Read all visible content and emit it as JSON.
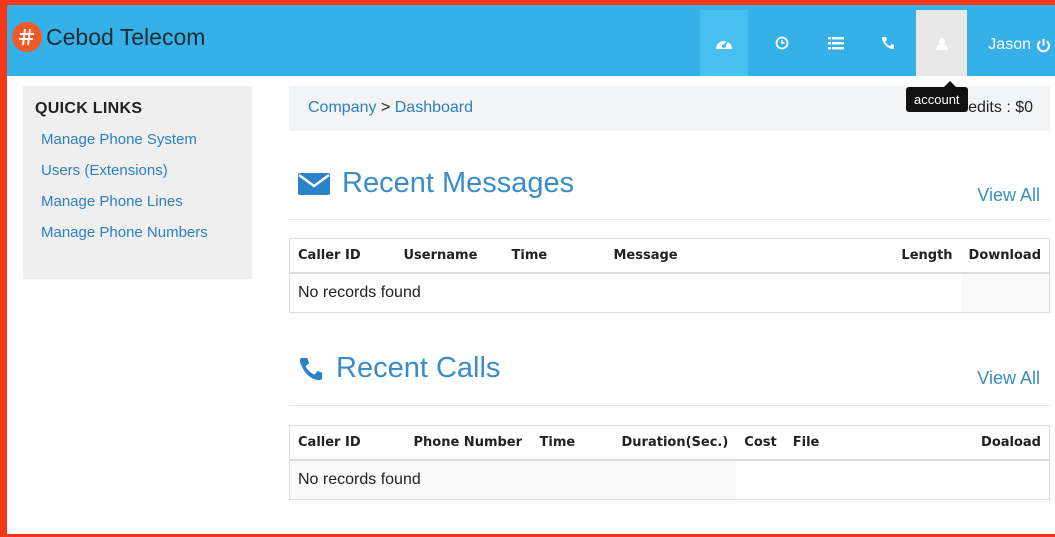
{
  "app": {
    "title": "Cebod Telecom"
  },
  "header": {
    "icons": [
      {
        "name": "dashboard-icon",
        "glyph": "◕",
        "active": true
      },
      {
        "name": "history-icon",
        "glyph": "◷"
      },
      {
        "name": "list-icon",
        "glyph": "☰"
      },
      {
        "name": "phone-icon",
        "glyph": "☎"
      },
      {
        "name": "account-icon",
        "glyph": "☺"
      }
    ],
    "user_name": "Jason",
    "logout_glyph": "⏻",
    "tooltip": "account"
  },
  "sidebar": {
    "title": "QUICK LINKS",
    "items": [
      {
        "label": "Manage Phone System"
      },
      {
        "label": "Users (Extensions)"
      },
      {
        "label": "Manage Phone Lines"
      },
      {
        "label": "Manage Phone Numbers"
      }
    ]
  },
  "breadcrumb": {
    "parent": "Company",
    "separator": ">",
    "current": "Dashboard",
    "credits": "Credits : $0"
  },
  "messages": {
    "title": "Recent Messages",
    "view_all": "View All",
    "columns": [
      "Caller ID",
      "Username",
      "Time",
      "Message",
      "Length",
      "Download"
    ],
    "empty": "No records found"
  },
  "calls": {
    "title": "Recent Calls",
    "view_all": "View All",
    "columns": [
      "Caller ID",
      "Phone Number",
      "Time",
      "Duration(Sec.)",
      "Cost",
      "File",
      "Doaload"
    ],
    "empty": "No records found"
  },
  "colors": {
    "header": "#35b1e8",
    "accent": "#3a8dc8",
    "logo": "#f05a28"
  }
}
